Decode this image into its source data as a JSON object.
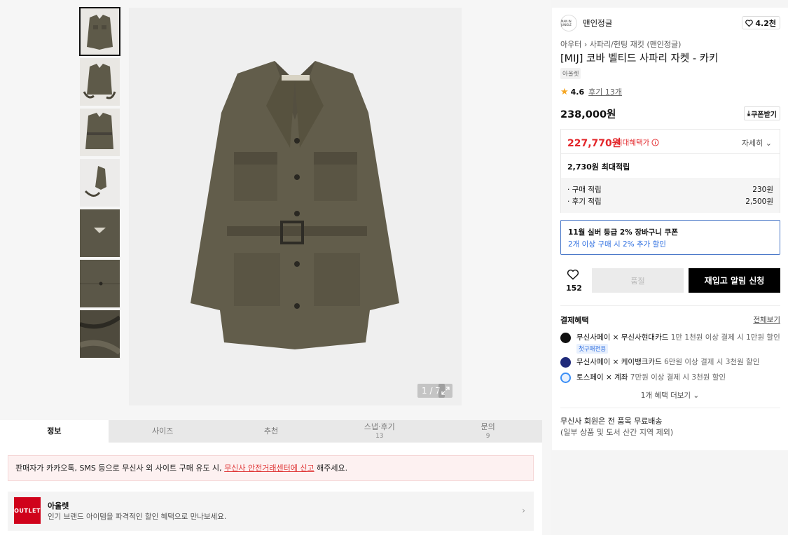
{
  "gallery": {
    "counter": "1 / 7",
    "thumbnails": [
      "jacket-front",
      "jacket-front-belt-open",
      "jacket-front-belted",
      "jacket-back",
      "jacket-collar-detail",
      "jacket-pocket-detail",
      "jacket-fabric-detail"
    ]
  },
  "tabs": [
    {
      "label": "정보",
      "sub": ""
    },
    {
      "label": "사이즈",
      "sub": ""
    },
    {
      "label": "추천",
      "sub": ""
    },
    {
      "label": "스냅·후기",
      "sub": "13"
    },
    {
      "label": "문의",
      "sub": "9"
    }
  ],
  "notice": {
    "text_before": "판매자가 카카오톡, SMS 등으로 무신사 외 사이트 구매 유도 시, ",
    "link": "무신사 안전거래센터에 신고",
    "text_after": " 해주세요."
  },
  "outlet": {
    "logo": "OUTLET",
    "title": "아울렛",
    "desc": "인기 브랜드 아이템을 파격적인 할인 혜택으로 만나보세요."
  },
  "product": {
    "brand": "맨인정글",
    "brand_logo_text": "MAN IN JUNGLE",
    "likes_short": "4.2천",
    "crumb_cat": "아우터",
    "crumb_sub": "사파리/헌팅 재킷 (맨인정글)",
    "title": "[MIJ] 코바 벨티드 사파리 자켓 - 카키",
    "badge": "아울렛",
    "rating": "4.6",
    "reviews": "후기 13개",
    "price": "238,000원",
    "coupon_btn": "쿠폰받기"
  },
  "benefit": {
    "max_price": "227,770원",
    "max_label": "최대혜택가",
    "detail": "자세히",
    "points_total": "2,730원 최대적립",
    "rows": [
      {
        "label": "· 구매 적립",
        "value": "230원"
      },
      {
        "label": "· 후기 적립",
        "value": "2,500원"
      }
    ]
  },
  "coupon": {
    "title": "11월 실버 등급 2% 장바구니 쿠폰",
    "sub": "2개 이상 구매 시 2% 추가 할인"
  },
  "actions": {
    "like_count": "152",
    "soldout": "품절",
    "restock": "재입고 알림 신청"
  },
  "payment": {
    "title": "결제혜택",
    "view_all": "전체보기",
    "items": [
      {
        "name": "무신사페이 × 무신사현대카드",
        "desc": " 1만 1천원 이상 결제 시 1만원 할인",
        "tag": "첫구매전용",
        "color": "#111111"
      },
      {
        "name": "무신사페이 × 케이뱅크카드",
        "desc": " 6만원 이상 결제 시 3천원 할인",
        "tag": "",
        "color": "#1f2a7a"
      },
      {
        "name": "토스페이 × 계좌",
        "desc": " 7만원 이상 결제 시 3천원 할인",
        "tag": "",
        "color": "#3a8ef6"
      }
    ],
    "more": "1개 혜택 더보기"
  },
  "shipping": {
    "line1": "무신사 회원은 전 품목 무료배송",
    "line2": "(일부 상품 및 도서 산간 지역 제외)"
  }
}
